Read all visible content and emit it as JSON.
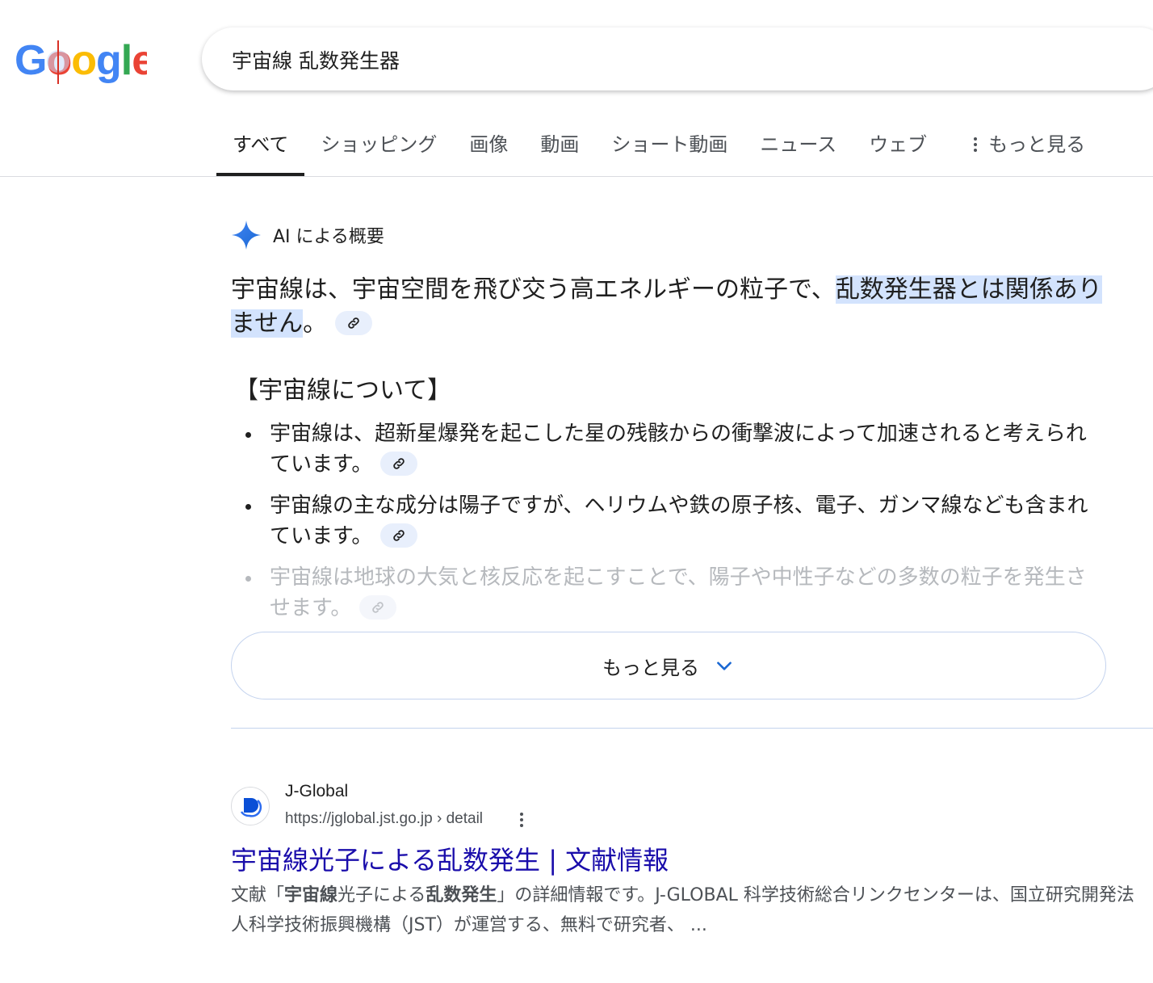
{
  "logo": {
    "text": "Google",
    "letters": [
      "G",
      "o",
      "o",
      "g",
      "l",
      "e"
    ]
  },
  "search": {
    "query": "宇宙線  乱数発生器"
  },
  "tabs": [
    {
      "label": "すべて",
      "active": true
    },
    {
      "label": "ショッピング"
    },
    {
      "label": "画像"
    },
    {
      "label": "動画"
    },
    {
      "label": "ショート動画"
    },
    {
      "label": "ニュース"
    },
    {
      "label": "ウェブ"
    }
  ],
  "tabs_more_label": "もっと見る",
  "ai_overview": {
    "header_label": "AI による概要",
    "lead_text": "宇宙線は、宇宙空間を飛び交う高エネルギーの粒子で、",
    "lead_highlight": "乱数発生器とは関係ありません",
    "lead_end": "。",
    "section_title": "【宇宙線について】",
    "bullets": [
      "宇宙線は、超新星爆発を起こした星の残骸からの衝撃波によって加速されると考えられています。",
      "宇宙線の主な成分は陽子ですが、ヘリウムや鉄の原子核、電子、ガンマ線なども含まれています。",
      "宇宙線は地球の大気と核反応を起こすことで、陽子や中性子などの多数の粒子を発生させます。"
    ],
    "more_button_label": "もっと見る"
  },
  "result": {
    "site_name": "J-Global",
    "url": "https://jglobal.jst.go.jp › detail",
    "title": "宇宙線光子による乱数発生 | 文献情報",
    "snippet_parts": [
      "文献「",
      "宇宙線",
      "光子による",
      "乱数発生",
      "」の詳細情報です。J-GLOBAL 科学技術総合リンクセンターは、国立研究開発法人科学技術振興機構（JST）が運営する、無料で研究者、 ..."
    ]
  },
  "colors": {
    "google_blue": "#4285f4",
    "google_red": "#ea4335",
    "google_yellow": "#fbbc05",
    "google_green": "#34a853",
    "link_title": "#1a0dab",
    "highlight": "#d3e3fd"
  }
}
